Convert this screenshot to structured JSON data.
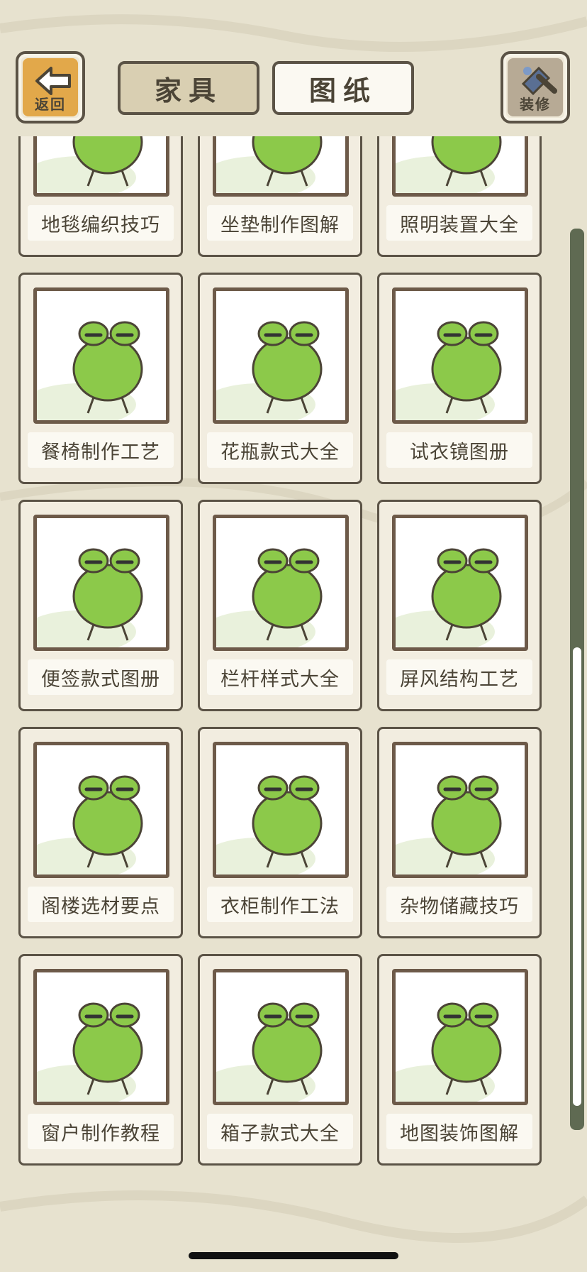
{
  "header": {
    "back_label": "返回",
    "decorate_label": "装修",
    "tabs": [
      {
        "label": "家具",
        "active": false
      },
      {
        "label": "图纸",
        "active": true
      }
    ]
  },
  "colors": {
    "background": "#e7e2cf",
    "frog": "#8cc94a",
    "border": "#5b5346",
    "tab_inactive": "#d9cfb2",
    "tab_active": "#fbf9f2",
    "scrollbar": "#5f6a52"
  },
  "items": [
    {
      "label": "地毯编织技巧",
      "icon": "rug-frog-icon"
    },
    {
      "label": "坐垫制作图解",
      "icon": "cushion-frog-icon"
    },
    {
      "label": "照明装置大全",
      "icon": "lamp-frog-icon"
    },
    {
      "label": "餐椅制作工艺",
      "icon": "chair-frog-icon"
    },
    {
      "label": "花瓶款式大全",
      "icon": "vase-frog-icon"
    },
    {
      "label": "试衣镜图册",
      "icon": "mirror-frog-icon"
    },
    {
      "label": "便签款式图册",
      "icon": "note-frog-icon"
    },
    {
      "label": "栏杆样式大全",
      "icon": "railing-frog-icon"
    },
    {
      "label": "屏风结构工艺",
      "icon": "screen-frog-icon"
    },
    {
      "label": "阁楼选材要点",
      "icon": "loft-frog-icon"
    },
    {
      "label": "衣柜制作工法",
      "icon": "wardrobe-frog-icon"
    },
    {
      "label": "杂物储藏技巧",
      "icon": "storage-frog-icon"
    },
    {
      "label": "窗户制作教程",
      "icon": "window-frog-icon"
    },
    {
      "label": "箱子款式大全",
      "icon": "box-frog-icon"
    },
    {
      "label": "地图装饰图解",
      "icon": "map-frog-icon"
    }
  ],
  "scrollbar": {
    "position_fraction": 1.0
  }
}
